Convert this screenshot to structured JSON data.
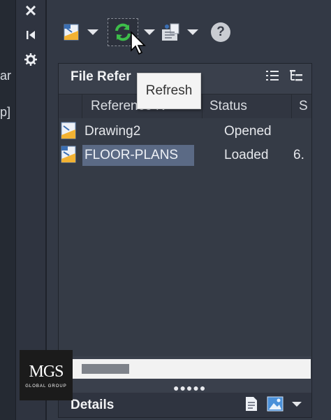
{
  "left_strip": {
    "cut_label_1": "ar",
    "cut_label_2": "p]"
  },
  "side_bar": {
    "icons": [
      "close-icon",
      "collapse-icon",
      "settings-icon"
    ]
  },
  "toolbar": {
    "attach_icon": "attach-dwg-icon",
    "refresh_icon": "refresh-icon",
    "external_files_icon": "external-files-icon",
    "help_label": "?"
  },
  "tooltip": {
    "text": "Refresh"
  },
  "panel": {
    "title": "File Refer",
    "columns": [
      {
        "label": "Reference N"
      },
      {
        "label": "Status"
      },
      {
        "label": "S"
      }
    ],
    "rows": [
      {
        "name": "Drawing2",
        "status": "Opened",
        "size": "",
        "selected": false
      },
      {
        "name": "FLOOR-PLANS",
        "status": "Loaded",
        "size": "6.",
        "selected": true
      }
    ]
  },
  "details": {
    "label": "Details"
  },
  "logo": {
    "mark": "MGS",
    "sub": "GLOBAL GROUP"
  },
  "colors": {
    "background": "#2b303b",
    "panel": "#3a404c",
    "selection": "#5b6a85",
    "refresh_green": "#3dbd4a",
    "attach_orange": "#f2b233"
  }
}
